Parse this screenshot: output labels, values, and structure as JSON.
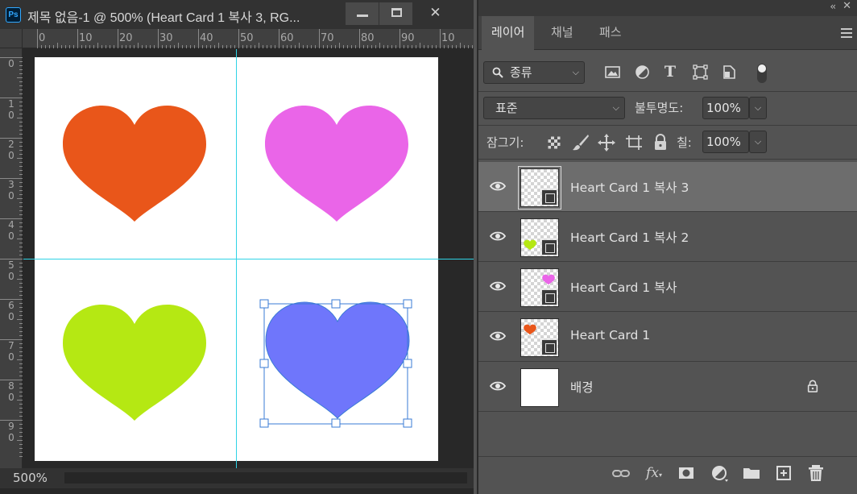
{
  "document": {
    "app_icon": "Ps",
    "title": "제목 없음-1 @ 500% (Heart Card 1 복사 3, RG...",
    "window_buttons": {
      "minimize": "minimize-icon",
      "maximize": "maximize-icon",
      "close": "✕"
    },
    "ruler_h_labels": [
      "0",
      "10",
      "20",
      "30",
      "40",
      "50",
      "60",
      "70",
      "80",
      "90",
      "10"
    ],
    "ruler_v_labels": [
      [
        "0"
      ],
      [
        "1",
        "0"
      ],
      [
        "2",
        "0"
      ],
      [
        "3",
        "0"
      ],
      [
        "4",
        "0"
      ],
      [
        "5",
        "0"
      ],
      [
        "6",
        "0"
      ],
      [
        "7",
        "0"
      ],
      [
        "8",
        "0"
      ],
      [
        "9",
        "0"
      ]
    ],
    "hearts": [
      {
        "name": "orange",
        "color": "#e9561a"
      },
      {
        "name": "pink",
        "color": "#ea65e8"
      },
      {
        "name": "lime",
        "color": "#b5e813"
      },
      {
        "name": "blue",
        "color": "#6f76fb"
      }
    ],
    "guide_color": "#2fd3e6",
    "zoom": "500%"
  },
  "panel": {
    "collapse_label": "‹‹",
    "close_label": "✕",
    "tabs": [
      {
        "label": "레이어",
        "active": true
      },
      {
        "label": "채널",
        "active": false
      },
      {
        "label": "패스",
        "active": false
      }
    ],
    "filter": {
      "kind_label": "종류",
      "icons": [
        "image-filter-icon",
        "adjustment-filter-icon",
        "type-filter-icon",
        "shape-filter-icon",
        "smart-object-filter-icon",
        "filter-toggle-icon"
      ]
    },
    "blend_mode": "표준",
    "opacity_label": "불투명도:",
    "opacity_value": "100%",
    "lock_label": "잠그기:",
    "lock_icons": [
      "lock-transparency-icon",
      "lock-paint-icon",
      "lock-position-icon",
      "lock-artboard-icon",
      "lock-all-icon"
    ],
    "fill_label": "칠:",
    "fill_value": "100%",
    "layers": [
      {
        "name": "Heart Card 1 복사 3",
        "selected": true,
        "thumb_heart": "",
        "smart_object": true,
        "locked": false
      },
      {
        "name": "Heart Card 1 복사 2",
        "selected": false,
        "thumb_heart": "#b5e813",
        "smart_object": true,
        "locked": false
      },
      {
        "name": "Heart Card 1 복사",
        "selected": false,
        "thumb_heart": "#ea65e8",
        "smart_object": true,
        "locked": false
      },
      {
        "name": "Heart Card 1",
        "selected": false,
        "thumb_heart": "#e9561a",
        "smart_object": true,
        "locked": false
      },
      {
        "name": "배경",
        "selected": false,
        "thumb_heart": "",
        "smart_object": false,
        "locked": true
      }
    ],
    "bottom_icons": [
      "link-layers-icon",
      "fx-icon",
      "add-mask-icon",
      "adjustment-layer-icon",
      "new-group-icon",
      "new-layer-icon",
      "delete-layer-icon"
    ],
    "fx_label": "fx"
  }
}
